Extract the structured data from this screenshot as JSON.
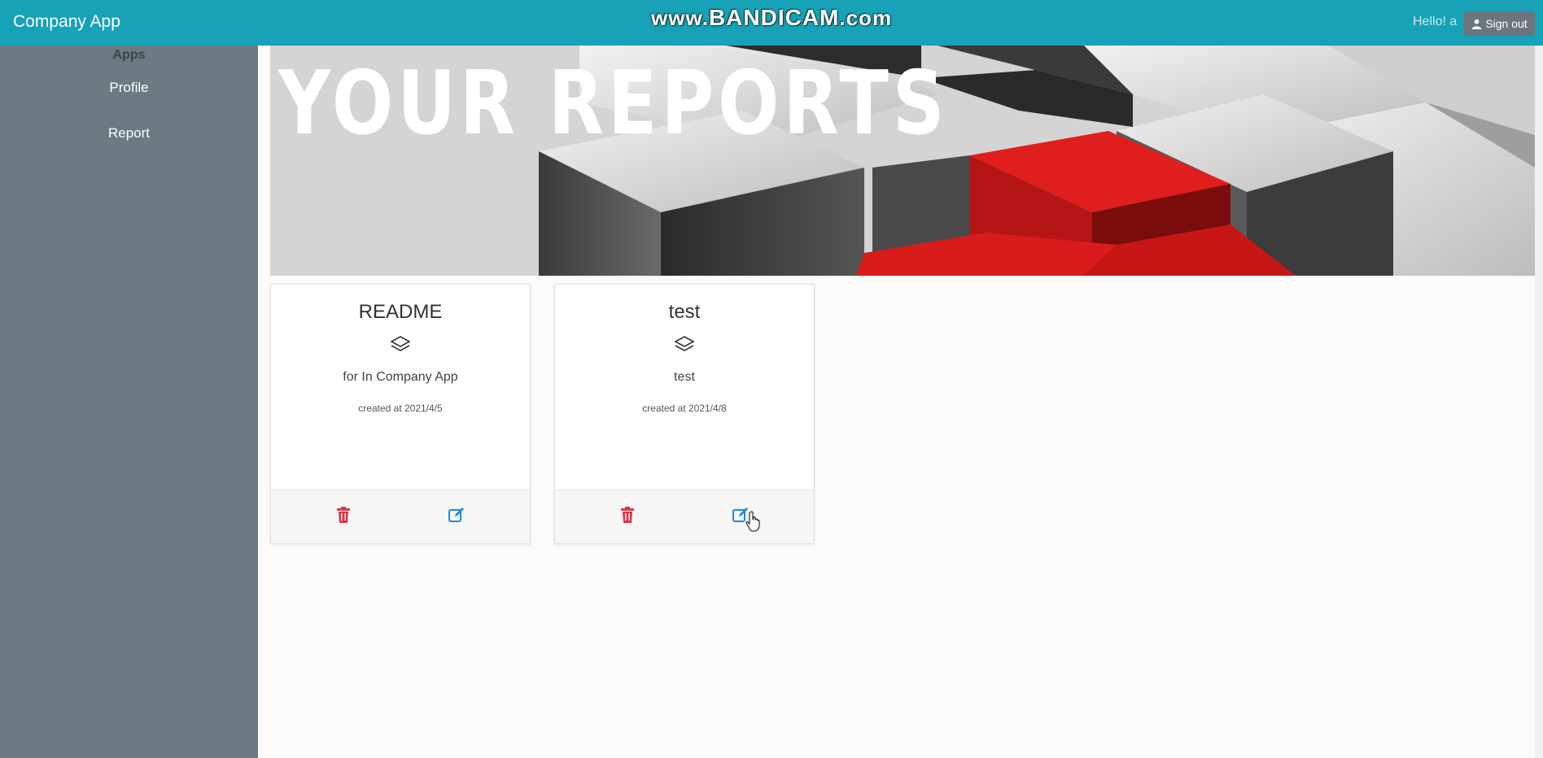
{
  "navbar": {
    "brand": "Company App",
    "watermark_prefix": "www.",
    "watermark_main": "BANDICAM",
    "watermark_suffix": ".com",
    "greeting": "Hello! a",
    "signout_label": "Sign out",
    "signout_icon": "user-icon"
  },
  "sidebar": {
    "heading": "Apps",
    "items": [
      {
        "label": "Profile"
      },
      {
        "label": "Report"
      }
    ]
  },
  "banner": {
    "title": "YOUR REPORTS"
  },
  "reports": [
    {
      "title": "README",
      "icon": "layers-icon",
      "description": "for In Company App",
      "created": "created at 2021/4/5"
    },
    {
      "title": "test",
      "icon": "layers-icon",
      "description": "test",
      "created": "created at 2021/4/8"
    }
  ],
  "colors": {
    "navbar": "#17a2b8",
    "sidebar": "#6c7a82",
    "delete": "#dc3545",
    "edit": "#1e88e5"
  }
}
